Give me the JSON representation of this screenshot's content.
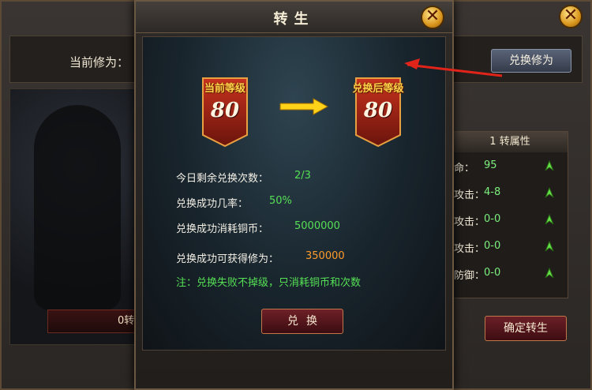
{
  "background_panel": {
    "current_label": "当前修为：",
    "current_value": " ",
    "exchange_button": "兑换修为",
    "portrait_bar_label": "0转",
    "attributes": {
      "title": "1 转属性",
      "rows": [
        {
          "name": "命：",
          "value": "95"
        },
        {
          "name": "攻击：",
          "value": "4-8"
        },
        {
          "name": "攻击：",
          "value": "0-0"
        },
        {
          "name": "攻击：",
          "value": "0-0"
        },
        {
          "name": "防御：",
          "value": "0-0"
        }
      ]
    },
    "confirm_button": "确定转生"
  },
  "dialog": {
    "title": "转生",
    "current_level_label": "当前等级",
    "current_level": "80",
    "after_level_label": "兑换后等级",
    "after_level": "80",
    "info": [
      {
        "label": "今日剩余兑换次数：",
        "value": "2/3",
        "color": "#55e055"
      },
      {
        "label": "兑换成功几率：",
        "value": "50%",
        "color": "#55e055"
      },
      {
        "label": "兑换成功消耗铜币：",
        "value": "5000000",
        "color": "#55e055"
      },
      {
        "label": "兑换成功可获得修为：",
        "value": "350000",
        "color": "#ff9b2a"
      }
    ],
    "note": "注：兑换失败不掉级，只消耗铜币和次数",
    "exchange_button": "兑换"
  },
  "icons": {
    "close": "close-icon",
    "upgrade_arrow": "green-up-arrow-icon",
    "level_arrow": "yellow-right-arrow-icon",
    "pointer": "red-pointer-arrow"
  },
  "colors": {
    "accent_gold": "#ffd24a",
    "value_green": "#55e055",
    "value_orange": "#ff9b2a",
    "banner_red": "#a0261a"
  }
}
